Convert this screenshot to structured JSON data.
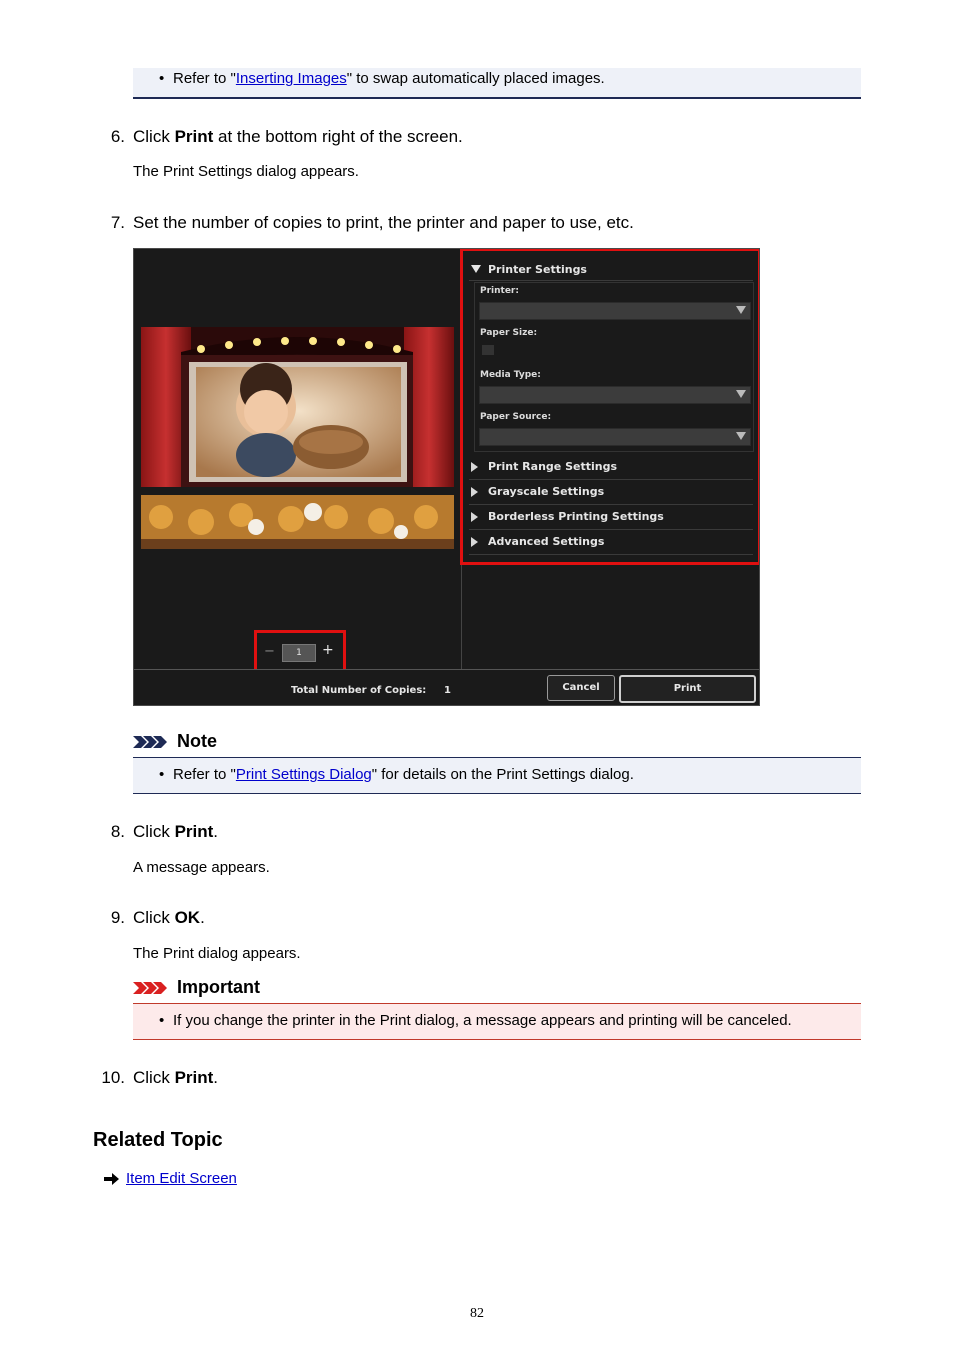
{
  "top_note": {
    "prefix": "Refer to \"",
    "link": "Inserting Images",
    "suffix": "\" to swap automatically placed images."
  },
  "steps": {
    "s6": {
      "num": "6.",
      "pre": "Click ",
      "bold": "Print",
      "post": " at the bottom right of the screen.",
      "desc": "The Print Settings dialog appears."
    },
    "s7": {
      "num": "7.",
      "text": "Set the number of copies to print, the printer and paper to use, etc."
    },
    "s8": {
      "num": "8.",
      "pre": "Click ",
      "bold": "Print",
      "post": ".",
      "desc": "A message appears."
    },
    "s9": {
      "num": "9.",
      "pre": "Click ",
      "bold": "OK",
      "post": ".",
      "desc": "The Print dialog appears."
    },
    "s10": {
      "num": "10.",
      "pre": "Click ",
      "bold": "Print",
      "post": "."
    }
  },
  "screenshot": {
    "printer_settings": "Printer Settings",
    "printer_label": "Printer:",
    "paper_size_label": "Paper Size:",
    "media_type_label": "Media Type:",
    "paper_source_label": "Paper Source:",
    "sections": [
      "Print Range Settings",
      "Grayscale Settings",
      "Borderless Printing Settings",
      "Advanced Settings"
    ],
    "copies_value": "1",
    "minus": "−",
    "plus": "+",
    "total_label": "Total Number of Copies:",
    "total_value": "1",
    "cancel": "Cancel",
    "print": "Print"
  },
  "note": {
    "heading": "Note",
    "prefix": "Refer to \"",
    "link": "Print Settings Dialog",
    "suffix": "\" for details on the Print Settings dialog."
  },
  "important": {
    "heading": "Important",
    "text": "If you change the printer in the Print dialog, a message appears and printing will be canceled."
  },
  "related": {
    "heading": "Related Topic",
    "link": "Item Edit Screen"
  },
  "page_number": "82",
  "colors": {
    "link": "#0000cc",
    "highlight": "#e01010",
    "note_bar": "#1e2a55",
    "important_bar": "#c0392b"
  }
}
